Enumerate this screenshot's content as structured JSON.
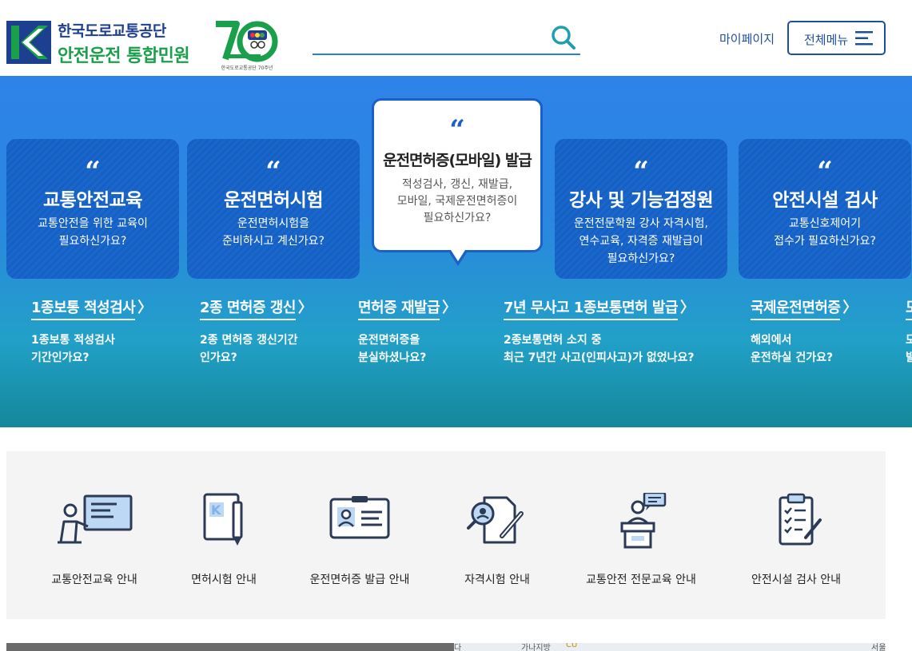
{
  "header": {
    "logo_line1": "한국도로교통공단",
    "logo_line2": "안전운전 통합민원",
    "anniversary_number": "70",
    "anniversary_caption": "한국도로교통공단 70주년",
    "search_placeholder": "",
    "mypage_label": "마이페이지",
    "menu_label": "전체메뉴"
  },
  "hero": {
    "cards": [
      {
        "quote": "“",
        "title": "교통안전교육",
        "desc": "교통안전을 위한 교육이\n필요하신가요?"
      },
      {
        "quote": "“",
        "title": "운전면허시험",
        "desc": "운전면허시험을\n준비하시고 계신가요?"
      },
      {
        "quote": "“",
        "title": "운전면허증(모바일) 발급",
        "desc": "적성검사, 갱신, 재발급,\n모바일, 국제운전면허증이\n필요하신가요?"
      },
      {
        "quote": "“",
        "title": "강사 및 기능검정원",
        "desc": "운전전문학원 강사 자격시험,\n연수교육, 자격증 재발급이\n필요하신가요?"
      },
      {
        "quote": "“",
        "title": "안전시설 검사",
        "desc": "교통신호제어기\n접수가 필요하신가요?"
      }
    ],
    "quick_links": [
      {
        "title": "1종보통 적성검사",
        "arrow": "〉",
        "desc": "1종보통 적성검사\n기간인가요?"
      },
      {
        "title": "2종 면허증 갱신",
        "arrow": "〉",
        "desc": "2종 면허증 갱신기간\n인가요?"
      },
      {
        "title": "면허증 재발급",
        "arrow": "〉",
        "desc": "운전면허증을\n분실하셨나요?"
      },
      {
        "title": "7년 무사고 1종보통면허 발급",
        "arrow": "〉",
        "desc": "2종보통면허 소지 중\n최근 7년간 사고(인피사고)가 없었나요?"
      },
      {
        "title": "국제운전면허증",
        "arrow": "〉",
        "desc": "해외에서\n운전하실 건가요?"
      },
      {
        "title": "모",
        "arrow": "",
        "desc": "모\n발"
      }
    ]
  },
  "guide": {
    "items": [
      {
        "label": "교통안전교육 안내",
        "icon": "lecture-board-icon"
      },
      {
        "label": "면허시험 안내",
        "icon": "exam-paper-pencil-icon"
      },
      {
        "label": "운전면허증 발급 안내",
        "icon": "id-card-icon"
      },
      {
        "label": "자격시험 안내",
        "icon": "certification-search-icon"
      },
      {
        "label": "교통안전 전문교육 안내",
        "icon": "speaker-podium-icon"
      },
      {
        "label": "안전시설 검사 안내",
        "icon": "checklist-clipboard-icon"
      }
    ]
  },
  "bottom": {
    "map_labels": [
      "다",
      "가나지방",
      "CU",
      "서울"
    ]
  },
  "colors": {
    "brand_blue": "#1d3f8f",
    "brand_green": "#1aa04a",
    "accent_blue": "#1d4f9f",
    "card_blue": "#1660c4"
  }
}
